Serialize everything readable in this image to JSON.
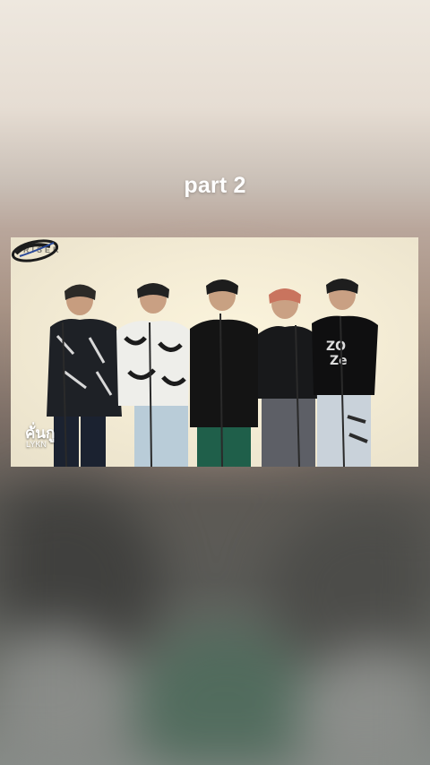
{
  "caption": "part 2",
  "video": {
    "channel_mark": "RISER",
    "brand_logo": "show-logo-icon",
    "song_title": "คั่นกู",
    "artist": "LYKN"
  },
  "colors": {
    "frame_background": "#f4ecd5",
    "caption_text": "#ffffff"
  }
}
